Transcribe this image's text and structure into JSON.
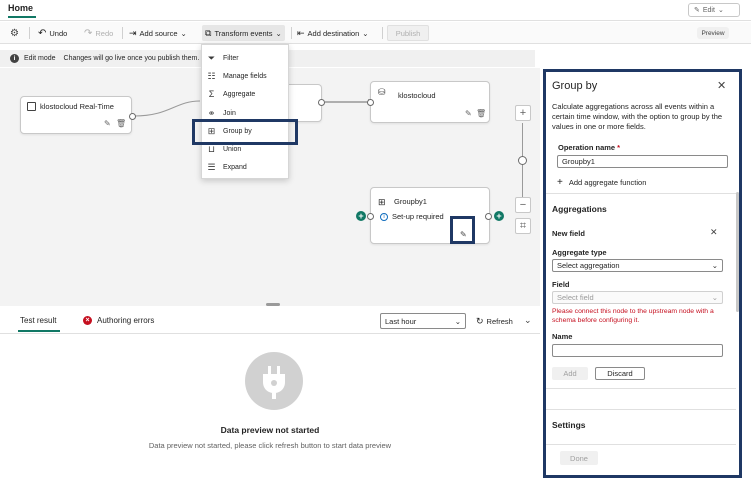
{
  "header": {
    "home_tab": "Home",
    "edit_label": "Edit"
  },
  "toolbar": {
    "undo": "Undo",
    "redo": "Redo",
    "add_source": "Add source",
    "transform_events": "Transform events",
    "add_destination": "Add destination",
    "publish": "Publish",
    "preview": "Preview"
  },
  "info_bar": {
    "mode": "Edit mode",
    "message": "Changes will go live once you publish them."
  },
  "menu": {
    "items": [
      {
        "label": "Filter",
        "icon": "filter-icon"
      },
      {
        "label": "Manage fields",
        "icon": "manage-fields-icon"
      },
      {
        "label": "Aggregate",
        "icon": "sigma-icon"
      },
      {
        "label": "Join",
        "icon": "join-icon"
      },
      {
        "label": "Group by",
        "icon": "group-by-icon"
      },
      {
        "label": "Union",
        "icon": "union-icon"
      },
      {
        "label": "Expand",
        "icon": "expand-icon"
      }
    ]
  },
  "canvas": {
    "source_node": "klostocloud Real-Time",
    "destination_node": "klostocloud",
    "groupby_node": {
      "title": "Groupby1",
      "status": "Set-up required"
    }
  },
  "bottom": {
    "tab_test": "Test result",
    "tab_errors": "Authoring errors",
    "time_range": "Last hour",
    "refresh": "Refresh",
    "empty_title": "Data preview not started",
    "empty_sub": "Data preview not started, please click refresh button to start data preview"
  },
  "panel": {
    "title": "Group by",
    "description": "Calculate aggregations across all events within a certain time window, with the option to group by the values in one or more fields.",
    "operation_name_label": "Operation name",
    "required_mark": "*",
    "operation_name_value": "Groupby1",
    "add_aggregate": "Add aggregate function",
    "aggregations_heading": "Aggregations",
    "new_field": "New field",
    "aggregate_type_label": "Aggregate type",
    "aggregate_type_placeholder": "Select aggregation",
    "field_label": "Field",
    "field_placeholder": "Select field",
    "field_error": "Please connect this node to the upstream node with a schema before configuring it.",
    "name_label": "Name",
    "add_button": "Add",
    "discard_button": "Discard",
    "settings_heading": "Settings",
    "done_button": "Done"
  },
  "colors": {
    "accent": "#117865",
    "highlight_border": "#1f3864",
    "error": "#c50f1f"
  }
}
